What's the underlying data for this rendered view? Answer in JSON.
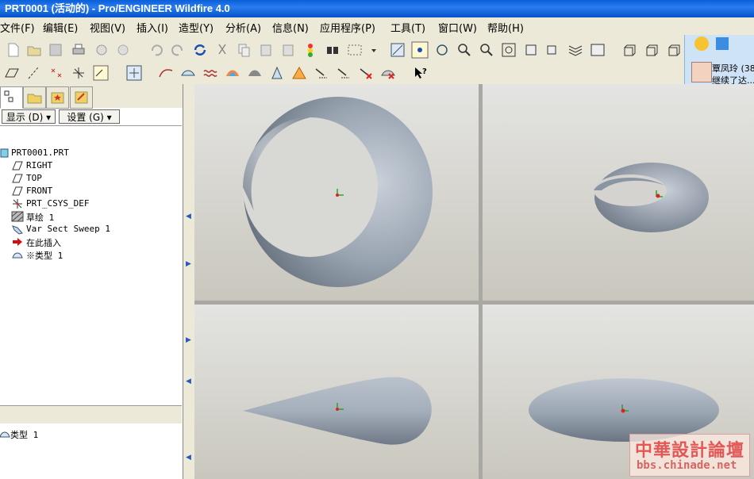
{
  "window": {
    "title": "PRT0001 (活动的) - Pro/ENGINEER Wildfire 4.0"
  },
  "menu": [
    {
      "label": "文件(F)"
    },
    {
      "label": "编辑(E)"
    },
    {
      "label": "视图(V)"
    },
    {
      "label": "插入(I)"
    },
    {
      "label": "造型(Y)"
    },
    {
      "label": "分析(A)"
    },
    {
      "label": "信息(N)"
    },
    {
      "label": "应用程序(P)"
    },
    {
      "label": "工具(T)"
    },
    {
      "label": "窗口(W)"
    },
    {
      "label": "帮助(H)"
    }
  ],
  "chat": {
    "name": "覃凤玲 (38",
    "status": "继续了达..."
  },
  "panel": {
    "show_button": "显示 (D) ▾",
    "settings_button": "设置 (G) ▾"
  },
  "tree": {
    "items": [
      {
        "label": "PRT0001.PRT"
      },
      {
        "label": "RIGHT"
      },
      {
        "label": "TOP"
      },
      {
        "label": "FRONT"
      },
      {
        "label": "PRT_CSYS_DEF"
      },
      {
        "label": "草绘 1"
      },
      {
        "label": "Var Sect Sweep 1"
      },
      {
        "label": "在此插入"
      },
      {
        "label": "※类型 1"
      }
    ]
  },
  "layers": {
    "items": [
      {
        "label": "类型 1"
      }
    ]
  },
  "watermark": {
    "line1": "中華設計論壇",
    "line2": "bbs.chinade.net"
  },
  "colors": {
    "titlebar": "#0a5fd8",
    "model": "#9aa4b0",
    "ui": "#ece9d8"
  }
}
